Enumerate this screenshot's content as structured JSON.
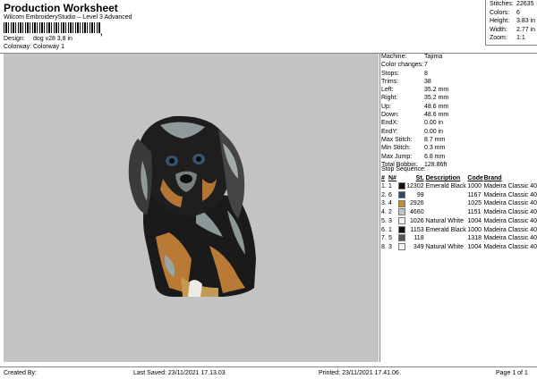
{
  "header": {
    "title": "Production Worksheet",
    "subtitle": "Wilcom EmbroideryStudio – Level 3 Advanced",
    "barcode_suffix": ","
  },
  "meta": {
    "design_label": "Design:",
    "design_value": "dog v28 3,8 in",
    "colorway_label": "Colorway:",
    "colorway_value": "Colorway 1"
  },
  "stats": [
    {
      "label": "Stitches:",
      "value": "22635"
    },
    {
      "label": "Colors:",
      "value": "6"
    },
    {
      "label": "Height:",
      "value": "3.83 in"
    },
    {
      "label": "Width:",
      "value": "2.77 in"
    },
    {
      "label": "Zoom:",
      "value": "1:1"
    }
  ],
  "info": [
    {
      "label": "Machine:",
      "value": "Tajima"
    },
    {
      "label": "Color changes:",
      "value": "7"
    },
    {
      "label": "Stops:",
      "value": "8"
    },
    {
      "label": "Trims:",
      "value": "38"
    },
    {
      "label": "Left:",
      "value": "35.2 mm"
    },
    {
      "label": "Right:",
      "value": "35.2 mm"
    },
    {
      "label": "Up:",
      "value": "48.6 mm"
    },
    {
      "label": "Down:",
      "value": "48.6 mm"
    },
    {
      "label": "EndX:",
      "value": "0.00 in"
    },
    {
      "label": "EndY:",
      "value": "0.00 in"
    },
    {
      "label": "Max Stitch:",
      "value": "8.7 mm"
    },
    {
      "label": "Min Stitch:",
      "value": "0.3 mm"
    },
    {
      "label": "Max Jump:",
      "value": "6.8 mm"
    },
    {
      "label": "Total Bobbin:",
      "value": "128.86ft"
    }
  ],
  "sequence": {
    "title": "Stop Sequence:",
    "headers": [
      "#",
      "N#",
      "",
      "St.",
      "Description",
      "Code",
      "Brand"
    ],
    "rows": [
      {
        "idx": "1.",
        "n": "1",
        "color": "#111111",
        "st": "12302",
        "desc": "Emerald Black",
        "code": "1000",
        "brand": "Madeira Classic 40"
      },
      {
        "idx": "2.",
        "n": "6",
        "color": "#2b4a6e",
        "st": "99",
        "desc": "",
        "code": "1167",
        "brand": "Madeira Classic 40"
      },
      {
        "idx": "3.",
        "n": "4",
        "color": "#c98a3a",
        "st": "2926",
        "desc": "",
        "code": "1025",
        "brand": "Madeira Classic 40"
      },
      {
        "idx": "4.",
        "n": "2",
        "color": "#c0c4c4",
        "st": "4660",
        "desc": "",
        "code": "1151",
        "brand": "Madeira Classic 40"
      },
      {
        "idx": "5.",
        "n": "3",
        "color": "#f4f2ee",
        "st": "1026",
        "desc": "Natural White",
        "code": "1004",
        "brand": "Madeira Classic 40"
      },
      {
        "idx": "6.",
        "n": "1",
        "color": "#111111",
        "st": "1153",
        "desc": "Emerald Black",
        "code": "1000",
        "brand": "Madeira Classic 40"
      },
      {
        "idx": "7.",
        "n": "5",
        "color": "#555555",
        "st": "118",
        "desc": "",
        "code": "1318",
        "brand": "Madeira Classic 40"
      },
      {
        "idx": "8.",
        "n": "3",
        "color": "#f4f2ee",
        "st": "349",
        "desc": "Natural White",
        "code": "1004",
        "brand": "Madeira Classic 40"
      }
    ]
  },
  "footer": {
    "created": "Created By:",
    "saved": "Last Saved: 23/11/2021 17.13.03",
    "printed": "Printed: 23/11/2021 17.41.06",
    "page": "Page 1 of 1"
  }
}
